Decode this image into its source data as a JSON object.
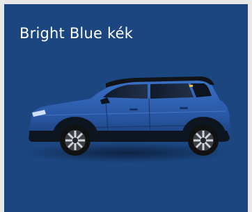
{
  "card": {
    "title": "Bright Blue kék",
    "image": "car-side-view",
    "colors": {
      "background": "#1b4680",
      "car_body": "#2f63b4",
      "title_text": "#ffffff"
    }
  }
}
